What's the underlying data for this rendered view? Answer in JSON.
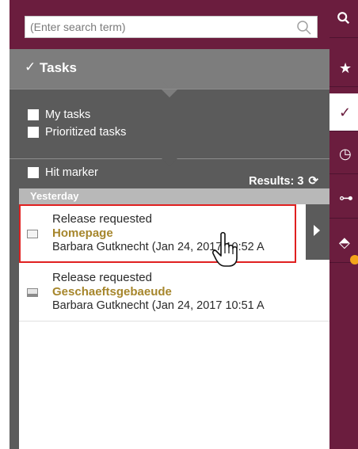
{
  "search": {
    "placeholder": "(Enter search term)",
    "icon": "search-icon"
  },
  "tasks": {
    "title": "Tasks",
    "check_glyph": "✓"
  },
  "filters": {
    "my_tasks": "My tasks",
    "prioritized_tasks": "Prioritized tasks",
    "hit_marker": "Hit marker"
  },
  "results": {
    "label": "Results: 3",
    "refresh_glyph": "⟳"
  },
  "group": {
    "header": "Yesterday"
  },
  "items": [
    {
      "line1": "Release requested",
      "line2": "Homepage",
      "line3": "Barbara Gutknecht (Jan 24, 2017 10:52 A",
      "selected": true
    },
    {
      "line1": "Release requested",
      "line2": "Geschaeftsgebaeude",
      "line3": "Barbara Gutknecht (Jan 24, 2017 10:51 A",
      "selected": false
    }
  ],
  "rail": {
    "buttons": [
      {
        "name": "search",
        "glyph": "🔍"
      },
      {
        "name": "favorites",
        "glyph": "★"
      },
      {
        "name": "tasks",
        "glyph": "✓"
      },
      {
        "name": "history",
        "glyph": "◷"
      },
      {
        "name": "workflow",
        "glyph": "⊶"
      },
      {
        "name": "release",
        "glyph": "⬘"
      }
    ]
  },
  "colors": {
    "brand": "#6b1d3e",
    "panel": "#5b5b5b",
    "highlight": "#e02020",
    "accent_text": "#a6862c"
  }
}
